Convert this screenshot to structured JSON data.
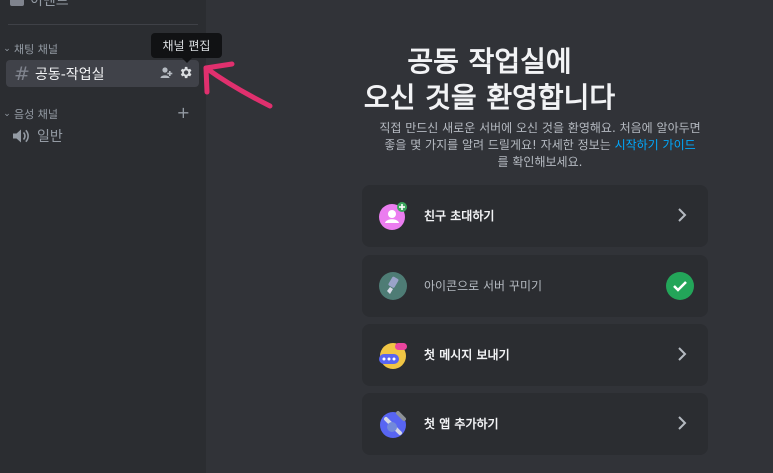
{
  "sidebar": {
    "top_item": "이벤트",
    "text_category": "채팅 채널",
    "active_channel": "공동-작업실",
    "voice_category": "음성 채널",
    "voice_channel": "일반",
    "tooltip": "채널 편집"
  },
  "main": {
    "title_line1": "공동 작업실에",
    "title_line2": "오신 것을 환영합니다",
    "desc_line1": "직접 만드신 새로운 서버에 오신 것을 환영해요. 처음에 알아두면",
    "desc_line2_a": "좋을 몇 가지를 알려 드릴게요! 자세한 정보는",
    "desc_link": "시작하기 가이드",
    "desc_line3": "를 확인해보세요.",
    "cards": [
      {
        "label": "친구 초대하기",
        "done": false
      },
      {
        "label": "아이콘으로 서버 꾸미기",
        "done": true
      },
      {
        "label": "첫 메시지 보내기",
        "done": false
      },
      {
        "label": "첫 앱 추가하기",
        "done": false
      }
    ]
  },
  "colors": {
    "accent": "#00a8fc",
    "success": "#23a559",
    "annotation": "#e0306e"
  }
}
